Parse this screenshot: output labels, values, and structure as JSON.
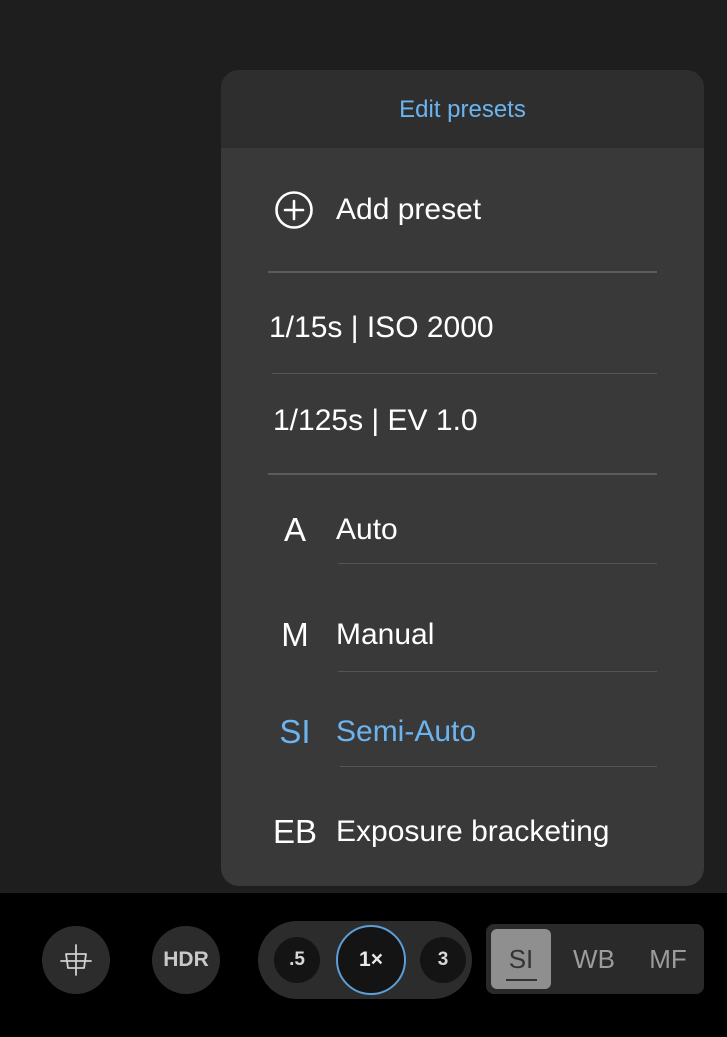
{
  "menu": {
    "header": "Edit presets",
    "add_preset": {
      "icon": "plus-circle-icon",
      "label": "Add preset"
    },
    "saved_presets": [
      "1/15s | ISO 2000",
      "1/125s | EV 1.0"
    ],
    "modes": [
      {
        "abbr": "A",
        "label": "Auto",
        "selected": false
      },
      {
        "abbr": "M",
        "label": "Manual",
        "selected": false
      },
      {
        "abbr": "SI",
        "label": "Semi-Auto",
        "selected": true
      },
      {
        "abbr": "EB",
        "label": "Exposure bracketing",
        "selected": false
      }
    ]
  },
  "toolbar": {
    "grid_icon": "grid-crosshair-icon",
    "hdr_label": "HDR",
    "zoom": [
      {
        "label": ".5",
        "selected": false
      },
      {
        "label": "1×",
        "selected": true
      },
      {
        "label": "3",
        "selected": false
      }
    ],
    "modes": [
      {
        "label": "SI",
        "selected": true
      },
      {
        "label": "WB",
        "selected": false
      },
      {
        "label": "MF",
        "selected": false
      }
    ]
  },
  "colors": {
    "accent": "#6cb4ef",
    "menu_bg": "#393939",
    "menu_header_bg": "#2e2e2e",
    "toolbar_bg": "#000000"
  }
}
